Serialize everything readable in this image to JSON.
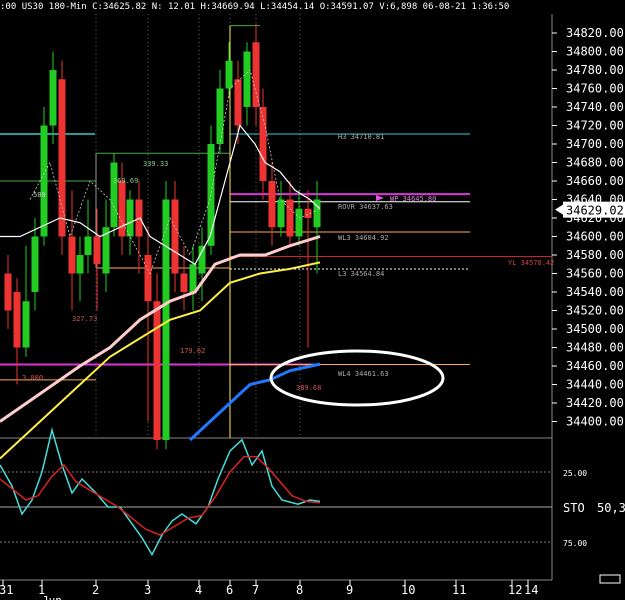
{
  "header": {
    "text": "US30  180-Min  C:34625.82  N:  12.01  H:34669.94  L:34454.14  O:34591.07  V:6,898  06-08-21  1:36:50",
    "prefix": ":00"
  },
  "price_axis": {
    "ticks": [
      "34820.00",
      "34800.00",
      "34780.00",
      "34760.00",
      "34740.00",
      "34720.00",
      "34700.00",
      "34680.00",
      "34660.00",
      "34640.00",
      "34620.00",
      "34600.00",
      "34580.00",
      "34560.00",
      "34540.00",
      "34520.00",
      "34500.00",
      "34480.00",
      "34460.00",
      "34440.00",
      "34420.00",
      "34400.00"
    ],
    "current_price": "34629.02"
  },
  "stoch_axis": {
    "label": "STO",
    "value": "50,3",
    "levels": [
      "25.00",
      "75.00"
    ]
  },
  "date_axis": {
    "labels": [
      "31",
      "1",
      "2",
      "3",
      "4",
      "6",
      "7",
      "8",
      "9",
      "10",
      "11",
      "12",
      "14"
    ],
    "month_label": "Jun"
  },
  "annotations": {
    "h3": "H3 34710.81",
    "wp": "WP 34645.80",
    "rovr": "ROVR 34637.63",
    "wl3": "WL3 34604.92",
    "yl": "YL 34578.42",
    "l3": "L3 34564.84",
    "wl4": "WL4 34461.63",
    "v339": "339.33",
    "v369": "369.69",
    "v500": "500",
    "v327": "327.73",
    "v179": "179.62",
    "v389": "389.68",
    "v3000": "3,000"
  },
  "colors": {
    "up_candle": "#22cc22",
    "down_candle": "#ee3333",
    "ma_white": "#ffffff",
    "ma_pink": "#ffcccc",
    "ma_yellow": "#ffee44",
    "ma_blue": "#2277ff",
    "stoch_cyan": "#44dddd",
    "stoch_red": "#dd2222",
    "line_cyan": "#33cccc",
    "line_magenta": "#dd33dd",
    "line_orange": "#ffaa55",
    "line_red": "#cc2222",
    "ellipse": "#ffffff"
  }
}
